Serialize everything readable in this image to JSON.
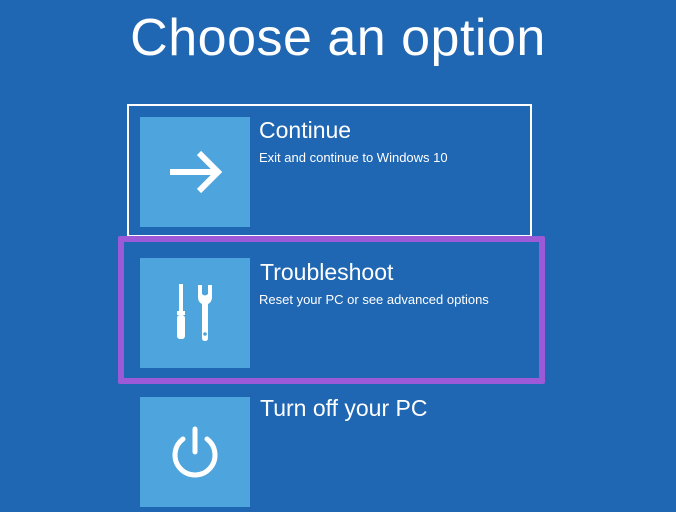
{
  "page": {
    "title": "Choose an option",
    "background_color": "#1f66b3",
    "tile_color": "#4ea4dc",
    "highlight_color": "#9d5ad8"
  },
  "options": [
    {
      "label": "Continue",
      "description": "Exit and continue to Windows 10",
      "icon": "arrow-right-icon"
    },
    {
      "label": "Troubleshoot",
      "description": "Reset your PC or see advanced options",
      "icon": "tools-icon",
      "highlighted": true
    },
    {
      "label": "Turn off your PC",
      "description": "",
      "icon": "power-icon"
    }
  ]
}
